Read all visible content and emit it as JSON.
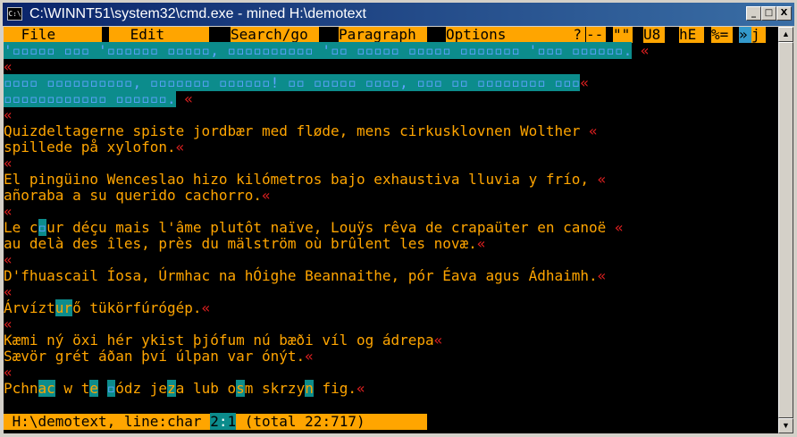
{
  "window": {
    "title": "C:\\WINNT51\\system32\\cmd.exe - mined H:\\demotext",
    "icon_label": "C:\\",
    "buttons": {
      "minimize": "_",
      "maximize": "□",
      "close": "X"
    }
  },
  "menubar": {
    "file": " File ",
    "edit": " Edit ",
    "search": "Search/go",
    "paragraph": "Paragraph",
    "options": "Options ",
    "help": "?",
    "dashes": "--",
    "quotes": "\"\"",
    "u8": "U8",
    "he": "hE",
    "pct": "%=",
    "raquo": "»",
    "j": "j"
  },
  "lines": {
    "l0": "'▫▫▫▫▫ ▫▫▫ '▫▫▫▫▫▫ ▫▫▫▫▫, ▫▫▫▫▫▫▫▫▫▫ '▫▫ ▫▫▫▫▫ ▫▫▫▫▫ ▫▫▫▫▫▫▫ '▫▫▫ ▫▫▫▫▫▫.",
    "l2": "▫▫▫▫ ▫▫▫▫▫▫▫▫▫▫, ▫▫▫▫▫▫▫ ▫▫▫▫▫▫! ▫▫ ▫▫▫▫▫ ▫▫▫▫, ▫▫▫ ▫▫ ▫▫▫▫▫▫▫▫ ▫▫▫",
    "l3": "▫▫▫▫▫▫▫▫▫▫▫▫ ▫▫▫▫▫▫.",
    "l5": "Quizdeltagerne spiste jordbær med fløde, mens cirkusklovnen Wolther ",
    "l6": "spillede på xylofon.",
    "l8": "El pingüino Wenceslao hizo kilómetros bajo exhaustiva lluvia y frío, ",
    "l9": "añoraba a su querido cachorro.",
    "l11a": "Le c",
    "l11b": "▫",
    "l11c": "ur déçu mais l'âme plutôt naïve, Louÿs rêva de crapaüter en canoë ",
    "l12": "au delà des îles, près du mälström où brûlent les novæ.",
    "l14": "D'fhuascail Íosa, Úrmhac na hÓighe Beannaithe, pór Éava agus Ádhaimh.",
    "l16a": "Árvízt",
    "l16b": "ur",
    "l16c": "ő tükörfúrógép.",
    "l18": "Kæmi ný öxi hér ykist þjófum nú bæði víl og ádrepa",
    "l19": "Sævör grét áðan því úlpan var ónýt.",
    "l21a": "Pchn",
    "l21b": "ac",
    "l21c": " w t",
    "l21d": "e",
    "l21e": " ",
    "l21f": "▫",
    "l21g": "ódz je",
    "l21h": "z",
    "l21i": "a lub o",
    "l21j": "s",
    "l21k": "m skrzy",
    "l21l": "n",
    "l21m": " fig.",
    "eol": "«",
    "trail": " «"
  },
  "status": {
    "left": " H:\\demotext, line:char ",
    "line": "2",
    "sep": ":",
    "char": "1",
    "right": " (total 22:717) "
  },
  "colors": {
    "title_bar": "#0a246a",
    "menu_bg": "#ffa500",
    "text": "#ffa500",
    "eol_marker": "#e02020",
    "block_bg": "#0c8c8c"
  }
}
